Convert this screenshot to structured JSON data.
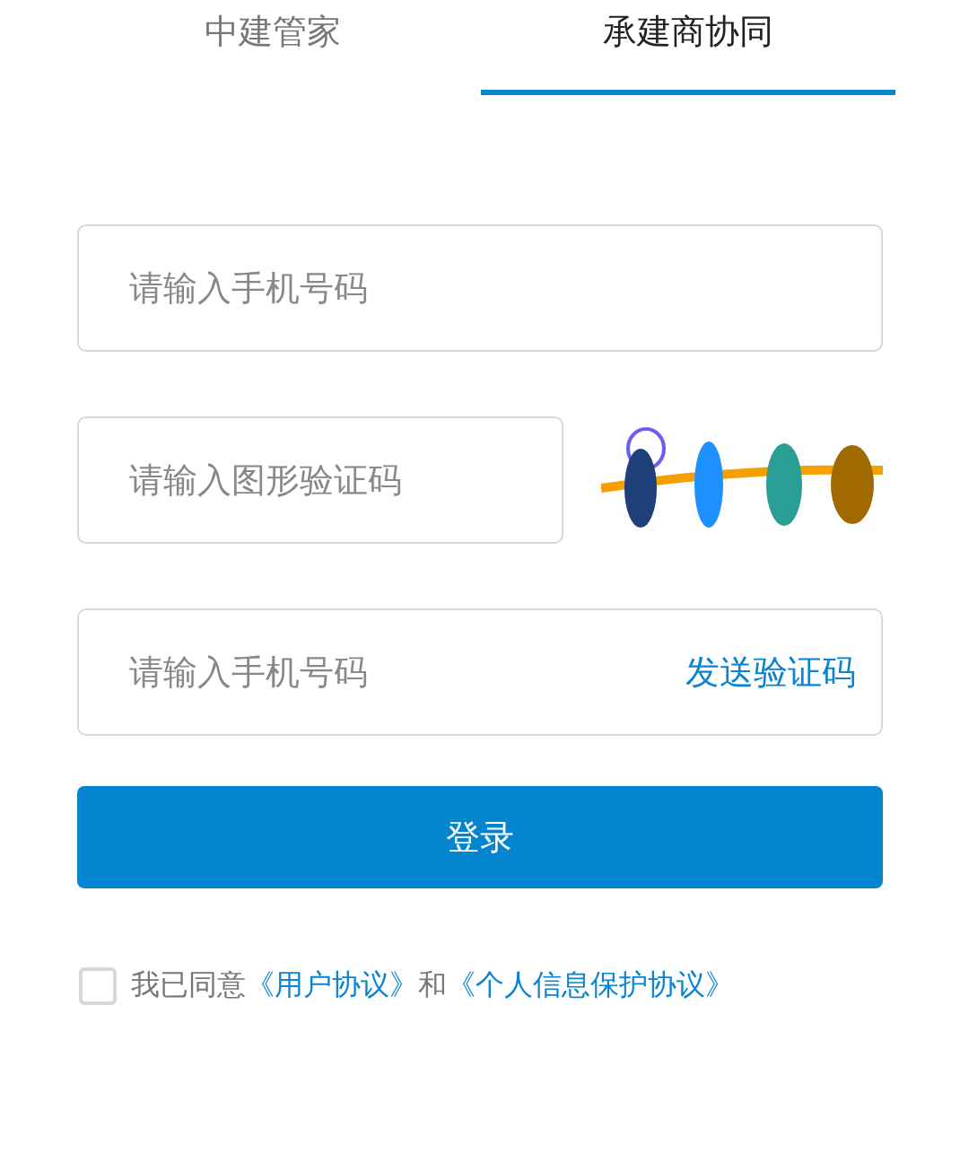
{
  "tabs": [
    {
      "label": "中建管家",
      "selected": false
    },
    {
      "label": "承建商协同",
      "selected": true
    }
  ],
  "phone_field": {
    "placeholder": "请输入手机号码"
  },
  "captcha_field": {
    "placeholder": "请输入图形验证码"
  },
  "sms_field": {
    "placeholder": "请输入手机号码",
    "send_code_button": "发送验证码"
  },
  "login_button": "登录",
  "agreement": {
    "checked": false,
    "text_before": "我已同意",
    "user_agreement_link": "《用户协议》",
    "conjunction": "和",
    "privacy_link": "《个人信息保护协议》"
  }
}
